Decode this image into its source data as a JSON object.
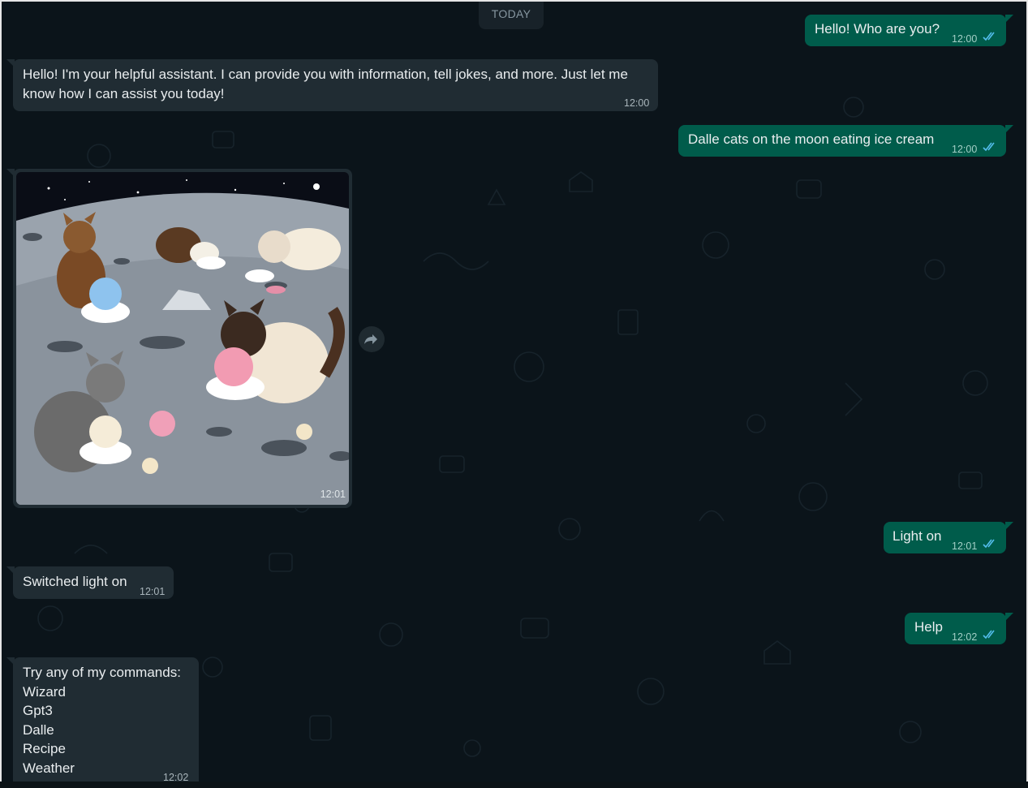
{
  "date_divider": "TODAY",
  "messages": [
    {
      "text": "Hello! Who are you?",
      "time": "12:00"
    },
    {
      "text": "Hello! I'm your helpful assistant. I can provide you with information, tell jokes, and more. Just let me\nknow how I can assist you today!",
      "time": "12:00"
    },
    {
      "text": "Dalle cats on the moon eating ice cream",
      "time": "12:00"
    },
    {
      "time": "12:01"
    },
    {
      "text": "Light on",
      "time": "12:01"
    },
    {
      "text": "Switched light on",
      "time": "12:01"
    },
    {
      "text": "Help",
      "time": "12:02"
    },
    {
      "text": "Try any of my commands:\nWizard\nGpt3\nDalle\nRecipe\nWeather",
      "time": "12:02"
    }
  ],
  "icons": {
    "read_receipt": "double-check-icon",
    "forward": "forward-icon"
  },
  "colors": {
    "background": "#0b141a",
    "incoming_bubble": "#202c33",
    "outgoing_bubble": "#005c4b",
    "read_tick": "#53bdeb"
  }
}
